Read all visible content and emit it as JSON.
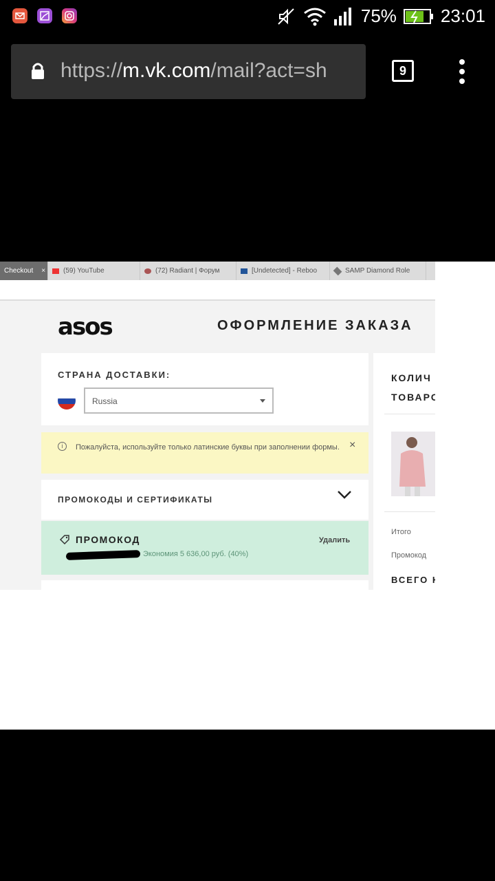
{
  "status_bar": {
    "battery_percent": "75%",
    "time": "23:01",
    "icons": [
      "mail-app-icon",
      "gallery-app-icon",
      "instagram-app-icon",
      "mute-icon",
      "wifi-icon",
      "signal-icon",
      "battery-charging-icon"
    ]
  },
  "browser": {
    "url_scheme": "https://",
    "url_host": "m.vk.com",
    "url_path": "/mail?act=sh",
    "tab_count": "9"
  },
  "screenshot": {
    "tabs": [
      "Checkout",
      "(59) YouTube",
      "(72) Radiant | Форум",
      "[Undetected] - Reboo",
      "SAMP Diamond Role"
    ],
    "brand": "asos",
    "page_title": "ОФОРМЛЕНИЕ ЗАКАЗА",
    "country_label": "СТРАНА ДОСТАВКИ:",
    "country_value": "Russia",
    "notice": "Пожалуйста, используйте только латинские буквы при заполнении формы.",
    "notice_close": "×",
    "promo_section": "ПРОМОКОДЫ И СЕРТИФИКАТЫ",
    "promo_label": "ПРОМОКОД",
    "promo_remove": "Удалить",
    "promo_saving": "Экономия 5 636,00 руб. (40%)",
    "right_title_line1": "КОЛИЧ",
    "right_title_line2": "ТОВАРО",
    "subtotal_label": "Итого",
    "promo_row_label": "Промокод",
    "total_label": "ВСЕГО К",
    "colors": {
      "notice_bg": "#fbf7c4",
      "promo_bg": "#cfeedd"
    }
  }
}
